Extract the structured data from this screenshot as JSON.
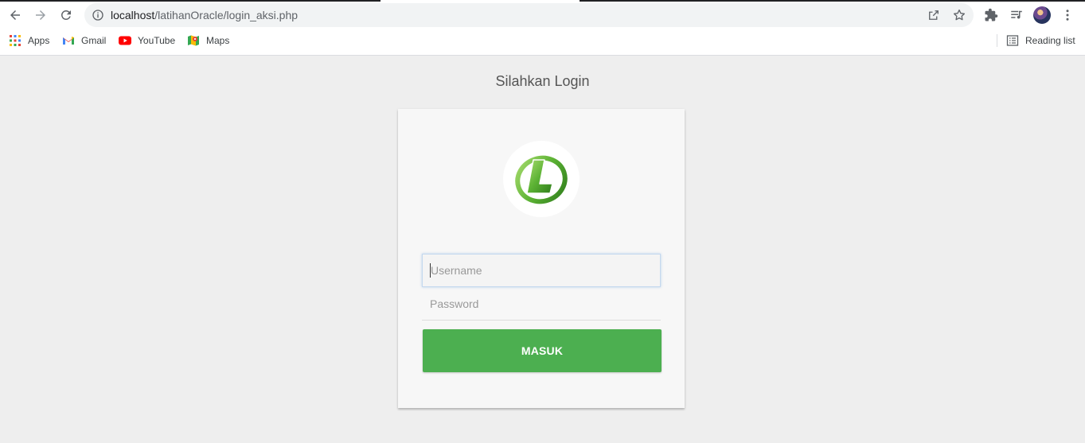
{
  "browser": {
    "url_host": "localhost",
    "url_path": "/latihanOracle/login_aksi.php",
    "icons": [
      "back-arrow-icon",
      "forward-arrow-icon",
      "reload-icon",
      "info-icon",
      "share-icon",
      "star-icon",
      "puzzle-icon",
      "reading-queue-icon",
      "kebab-menu-icon"
    ],
    "bookmarks": [
      {
        "label": "Apps",
        "icon": "apps-grid-icon"
      },
      {
        "label": "Gmail",
        "icon": "gmail-icon"
      },
      {
        "label": "YouTube",
        "icon": "youtube-icon"
      },
      {
        "label": "Maps",
        "icon": "maps-icon"
      }
    ],
    "reading_list": "Reading list"
  },
  "page": {
    "title": "Silahkan Login",
    "username_placeholder": "Username",
    "password_placeholder": "Password",
    "submit_label": "MASUK",
    "logo_icon": "green-l-logo-icon"
  },
  "colors": {
    "page_bg": "#eeeeee",
    "card_bg": "#f7f7f7",
    "button": "#4caf50",
    "logo_green": "#5cb234"
  }
}
